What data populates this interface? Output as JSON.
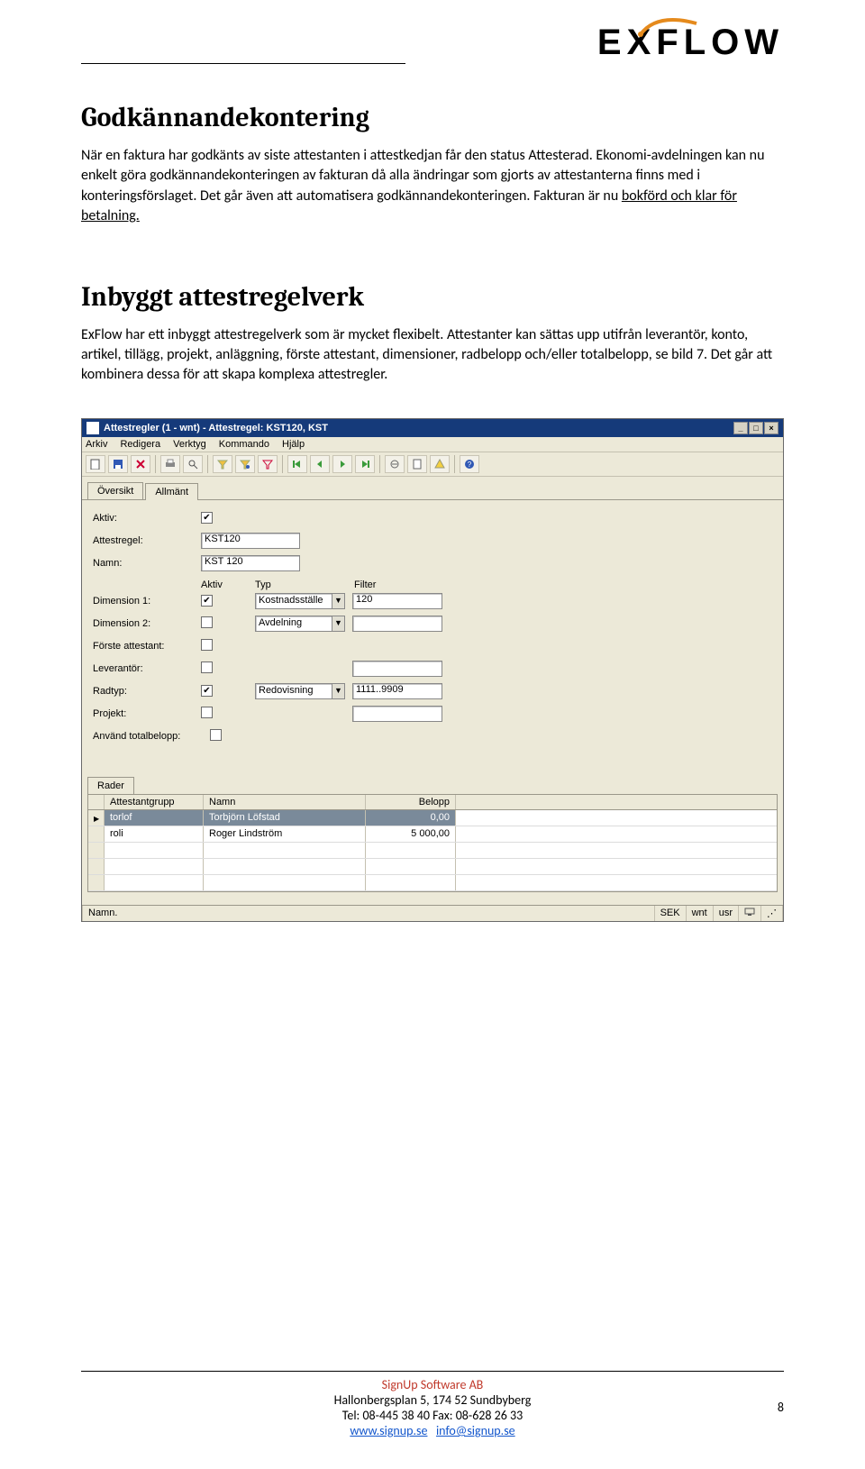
{
  "logo": "EXFLOW",
  "headings": {
    "godkannande": "Godkännandekontering",
    "inbyggt": "Inbyggt attestregelverk"
  },
  "paragraphs": {
    "p1": "När en faktura har godkänts av siste attestanten i attestkedjan får den status Attesterad. Ekonomi-avdelningen kan nu enkelt göra godkännandekonteringen av fakturan då alla ändringar som gjorts av attestanterna finns med i konteringsförslaget. Det går även att automatisera godkännandekonteringen. Fakturan är nu ",
    "p1_u": "bokförd och klar för betalning.",
    "p2": "ExFlow har ett inbyggt attestregelverk som är mycket flexibelt. Attestanter kan sättas upp utifrån leverantör, konto, artikel, tillägg, projekt, anläggning, förste attestant, dimensioner, radbelopp och/eller totalbelopp, se bild 7. Det går att kombinera dessa för att skapa komplexa attestregler."
  },
  "win": {
    "title": "Attestregler (1 - wnt) - Attestregel: KST120, KST",
    "menu": {
      "arkiv": "Arkiv",
      "redigera": "Redigera",
      "verktyg": "Verktyg",
      "kommando": "Kommando",
      "hjalp": "Hjälp"
    },
    "tabs": {
      "oversikt": "Översikt",
      "allmant": "Allmänt"
    },
    "form": {
      "aktiv_label": "Aktiv:",
      "attestregel_label": "Attestregel:",
      "attestregel_value": "KST120",
      "namn_label": "Namn:",
      "namn_value": "KST 120",
      "col_aktiv": "Aktiv",
      "col_typ": "Typ",
      "col_filter": "Filter",
      "dim1_label": "Dimension 1:",
      "dim1_sel": "Kostnadsställe",
      "dim1_filter": "120",
      "dim2_label": "Dimension 2:",
      "dim2_sel": "Avdelning",
      "forste_label": "Förste attestant:",
      "lev_label": "Leverantör:",
      "radtyp_label": "Radtyp:",
      "radtyp_sel": "Redovisning",
      "radtyp_filter": "1111..9909",
      "projekt_label": "Projekt:",
      "total_label": "Använd totalbelopp:"
    },
    "rader_tab": "Rader",
    "grid": {
      "h_grp": "Attestantgrupp",
      "h_namn": "Namn",
      "h_bel": "Belopp",
      "rows": [
        {
          "grp": "torlof",
          "namn": "Torbjörn Löfstad",
          "bel": "0,00"
        },
        {
          "grp": "roli",
          "namn": "Roger Lindström",
          "bel": "5 000,00"
        }
      ]
    },
    "status": {
      "text": "Namn.",
      "seg1": "SEK",
      "seg2": "wnt",
      "seg3": "usr"
    }
  },
  "footer": {
    "company": "SignUp Software AB",
    "addr": "Hallonbergsplan 5, 174 52 Sundbyberg",
    "tel": "Tel: 08-445 38 40  Fax: 08-628 26 33",
    "link1": "www.signup.se",
    "link2": "info@signup.se",
    "page": "8"
  }
}
